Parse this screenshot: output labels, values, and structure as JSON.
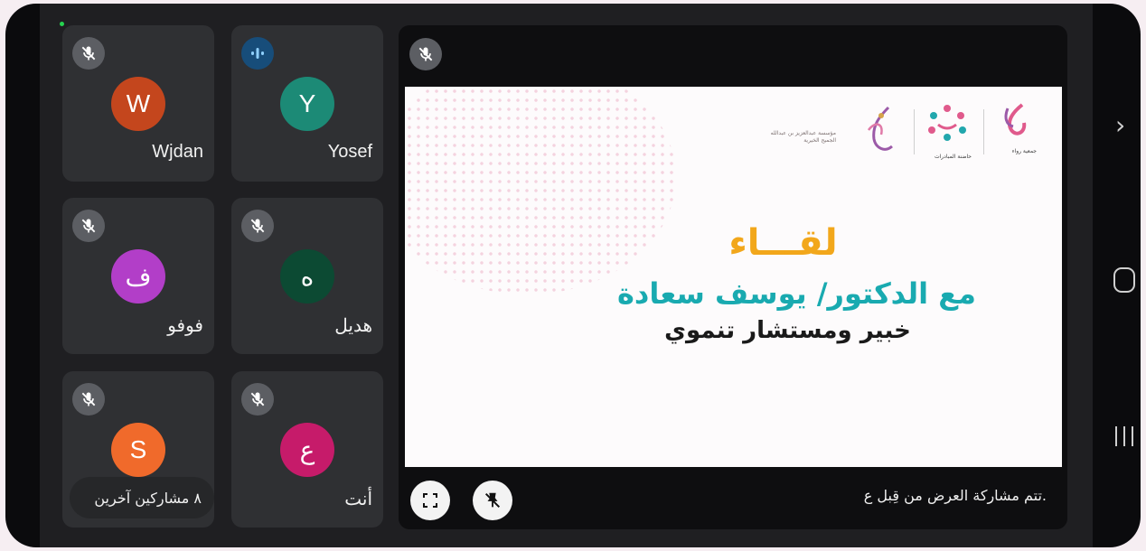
{
  "participants": [
    {
      "name": "Wjdan",
      "initial": "W",
      "color": "#c4461d",
      "mic": "muted"
    },
    {
      "name": "Yosef",
      "initial": "Y",
      "color": "#1c8a76",
      "mic": "speaking"
    },
    {
      "name": "فوفو",
      "initial": "ف",
      "color": "#b23ec8",
      "mic": "muted"
    },
    {
      "name": "هديل",
      "initial": "ه",
      "color": "#0c4a33",
      "mic": "muted"
    },
    {
      "name": "",
      "initial": "S",
      "color": "#f06a2b",
      "mic": "muted"
    },
    {
      "name": "أنت",
      "initial": "ع",
      "color": "#c61b6a",
      "mic": "muted"
    }
  ],
  "others_label": "٨ مشاركين آخرين",
  "presentation": {
    "slide_title": "لقـــاء",
    "slide_line2": "مع الدكتور/ يوسف سعادة",
    "slide_line3": "خبير ومستشار تنموي",
    "logo1_text": "مؤسسة عبدالعزيز بن عبدالله الجميح الخيرية",
    "logo2_text": "حاضنة المبادرات",
    "logo3_text": "جمعية رواء",
    "shared_by": "تتم مشاركة العرض من قِبل ع."
  },
  "colors": {
    "accent_title": "#f2a71b",
    "accent_teal": "#19aab0"
  },
  "icons": {
    "mic_muted": "mic-off-icon",
    "speaking": "audio-bars-icon",
    "fullscreen": "fullscreen-icon",
    "unpin": "unpin-icon"
  }
}
